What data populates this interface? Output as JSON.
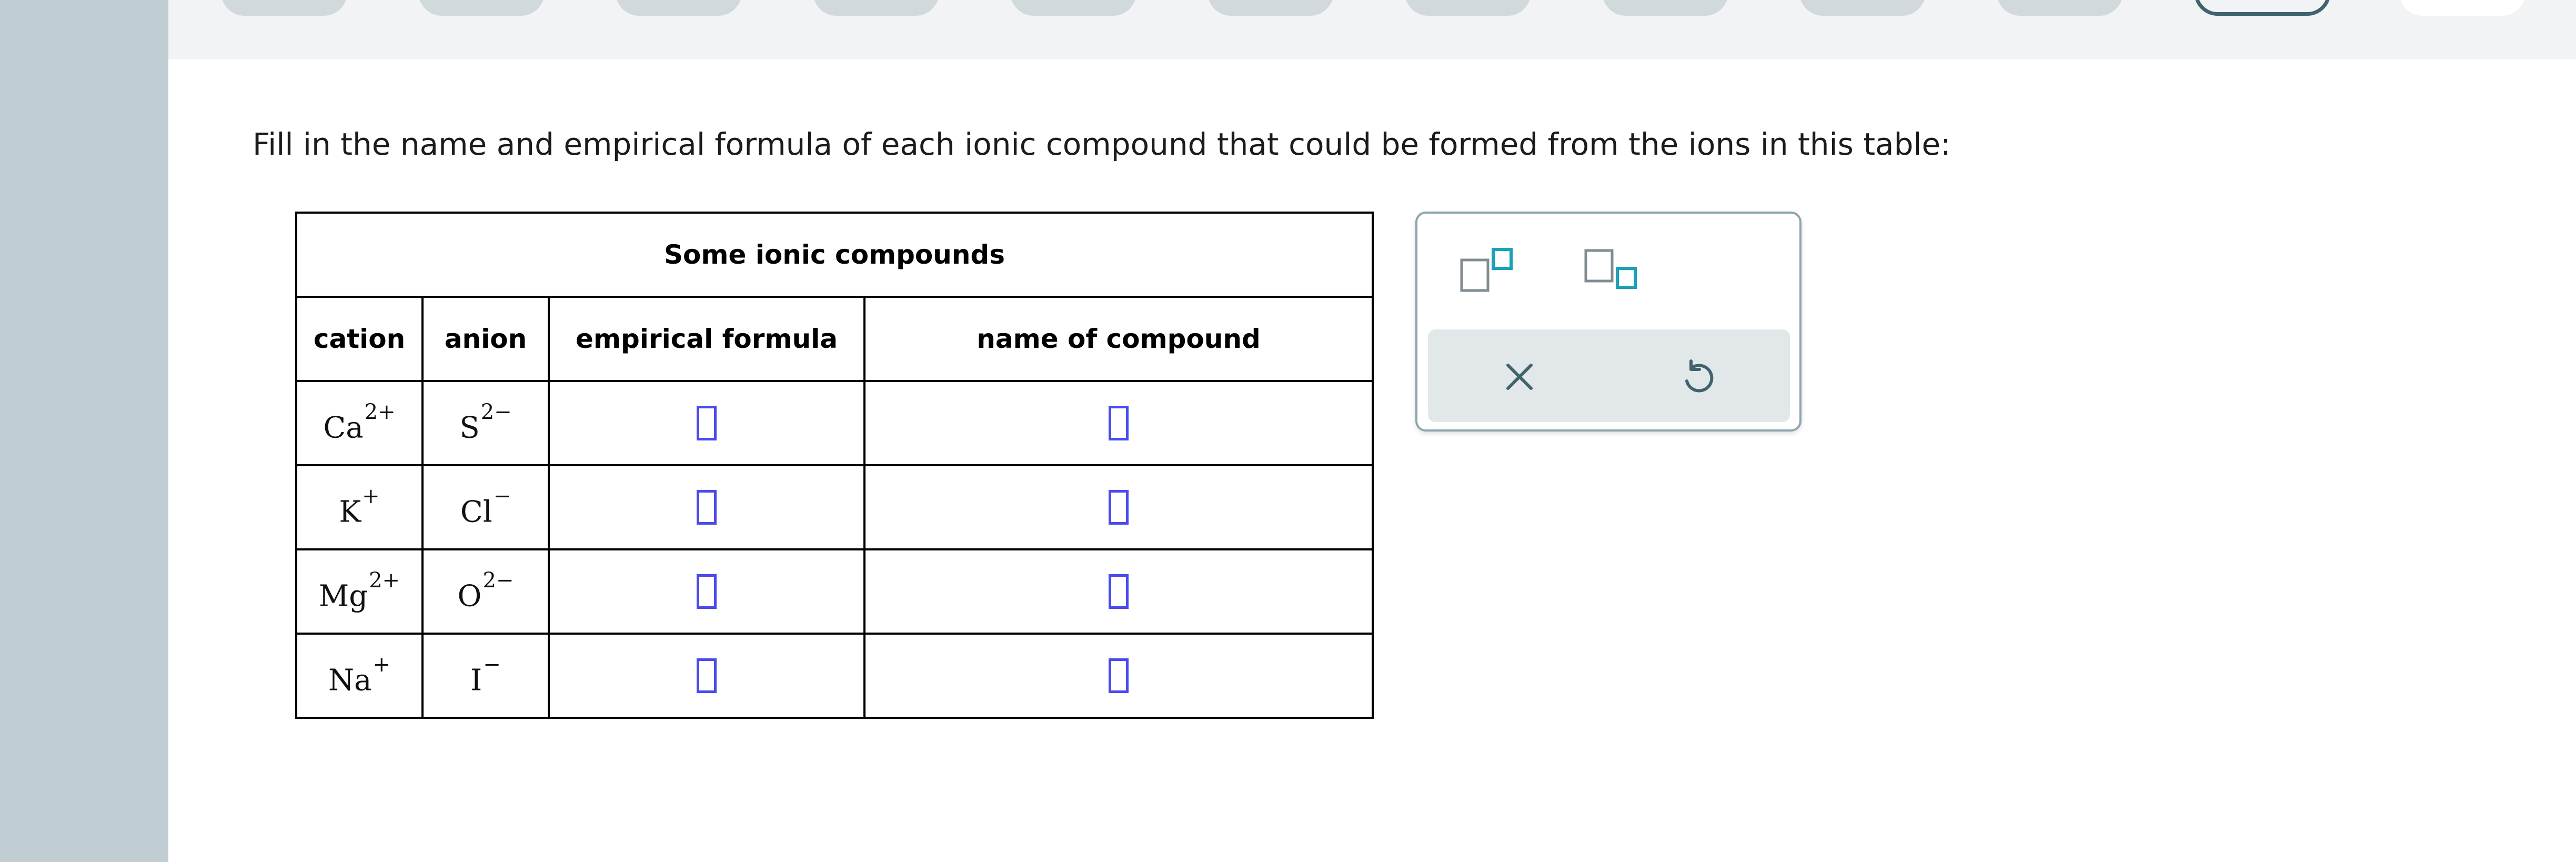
{
  "question": {
    "text": "Fill in the name and empirical formula of each ionic compound that could be formed from the ions in this table:"
  },
  "table": {
    "title": "Some ionic compounds",
    "headers": {
      "cation": "cation",
      "anion": "anion",
      "formula": "empirical formula",
      "name": "name of compound"
    },
    "rows": [
      {
        "cation": {
          "symbol": "Ca",
          "charge": "2+"
        },
        "anion": {
          "symbol": "S",
          "charge": "2−"
        },
        "formula": "",
        "name": ""
      },
      {
        "cation": {
          "symbol": "K",
          "charge": "+"
        },
        "anion": {
          "symbol": "Cl",
          "charge": "−"
        },
        "formula": "",
        "name": ""
      },
      {
        "cation": {
          "symbol": "Mg",
          "charge": "2+"
        },
        "anion": {
          "symbol": "O",
          "charge": "2−"
        },
        "formula": "",
        "name": ""
      },
      {
        "cation": {
          "symbol": "Na",
          "charge": "+"
        },
        "anion": {
          "symbol": "I",
          "charge": "−"
        },
        "formula": "",
        "name": ""
      }
    ]
  },
  "palette": {
    "buttons": [
      {
        "icon": "superscript-icon"
      },
      {
        "icon": "subscript-icon"
      }
    ],
    "actions": [
      {
        "icon": "clear-x-icon"
      },
      {
        "icon": "undo-icon"
      }
    ]
  },
  "colors": {
    "rail": "#c0cdd2",
    "topbar": "#f2f3f4",
    "answer_box": "#4a4aed",
    "palette_accent": "#1aa0b8",
    "palette_icon": "#40636e"
  }
}
